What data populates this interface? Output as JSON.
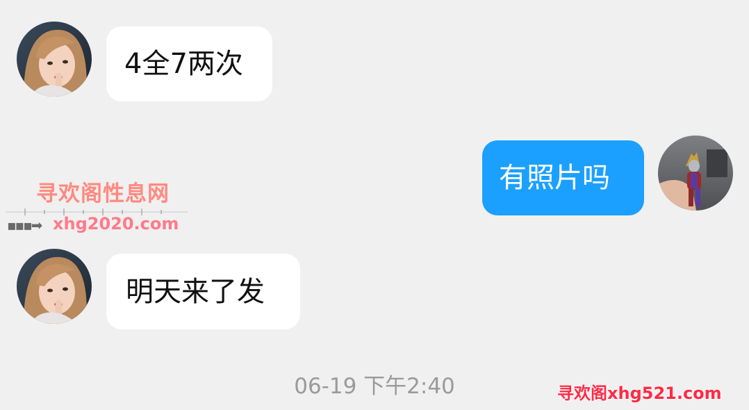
{
  "messages": [
    {
      "direction": "incoming",
      "text": "4全7两次",
      "avatar_icon": "woman-portrait-avatar-icon"
    },
    {
      "direction": "outgoing",
      "text": "有照片吗",
      "avatar_icon": "hero-figurine-avatar-icon"
    },
    {
      "direction": "incoming",
      "text": "明天来了发",
      "avatar_icon": "woman-portrait-avatar-icon"
    }
  ],
  "timestamp": "06-19 下午2:40",
  "watermarks": {
    "left_title": "寻欢阁性息网",
    "left_url": "xhg2020.com",
    "bottom_right": "寻欢阁xhg521.com"
  },
  "colors": {
    "background": "#f0f0f0",
    "incoming_bubble": "#ffffff",
    "outgoing_bubble": "#1ba0ff",
    "timestamp": "#9a9a9a"
  }
}
